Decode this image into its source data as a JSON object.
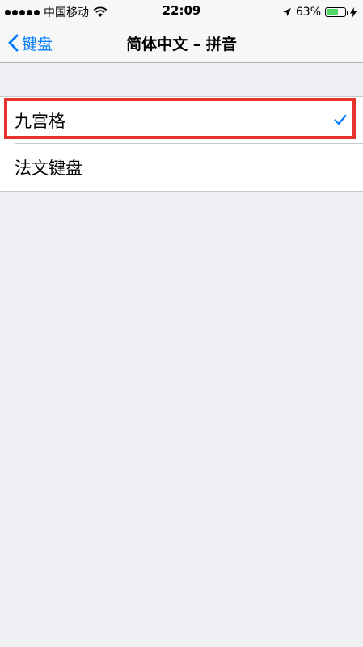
{
  "status_bar": {
    "carrier": "中国移动",
    "time": "22:09",
    "battery_percent": "63%",
    "battery_level": 0.63,
    "icons": [
      "signal-dots-icon",
      "wifi-icon",
      "location-arrow-icon",
      "battery-icon",
      "charging-bolt-icon"
    ]
  },
  "nav": {
    "back_label": "键盘",
    "title": "简体中文 – 拼音"
  },
  "options": [
    {
      "label": "九宫格",
      "selected": true
    },
    {
      "label": "法文键盘",
      "selected": false
    }
  ],
  "colors": {
    "accent": "#007aff",
    "highlight": "#e5322d",
    "background": "#efeff4",
    "battery": "#4cd964"
  }
}
